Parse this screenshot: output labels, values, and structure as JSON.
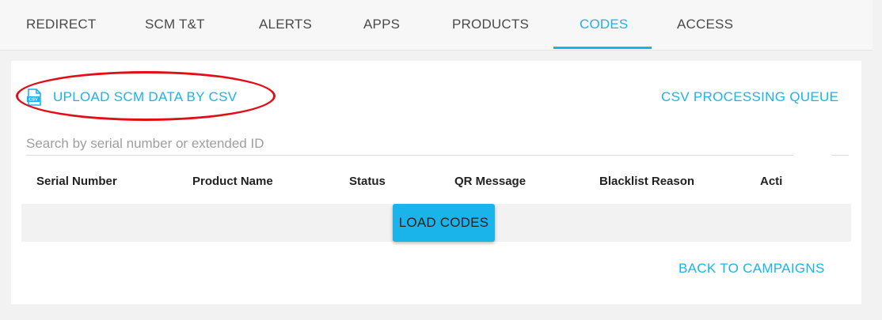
{
  "tabs": [
    {
      "label": "REDIRECT",
      "active": false
    },
    {
      "label": "SCM T&T",
      "active": false
    },
    {
      "label": "ALERTS",
      "active": false
    },
    {
      "label": "APPS",
      "active": false
    },
    {
      "label": "PRODUCTS",
      "active": false
    },
    {
      "label": "CODES",
      "active": true
    },
    {
      "label": "ACCESS",
      "active": false
    }
  ],
  "actions": {
    "upload_label": "UPLOAD SCM DATA BY CSV",
    "upload_icon": "csv-file-icon",
    "queue_label": "CSV PROCESSING QUEUE",
    "back_label": "BACK TO CAMPAIGNS"
  },
  "search": {
    "placeholder": "Search by serial number or extended ID",
    "value": ""
  },
  "table": {
    "columns": [
      "Serial Number",
      "Product Name",
      "Status",
      "QR Message",
      "Blacklist Reason",
      "Acti"
    ],
    "load_button": "LOAD CODES"
  },
  "colors": {
    "accent": "#1ab4ea",
    "highlight": "#e30d17",
    "background": "#f2f2f2"
  }
}
